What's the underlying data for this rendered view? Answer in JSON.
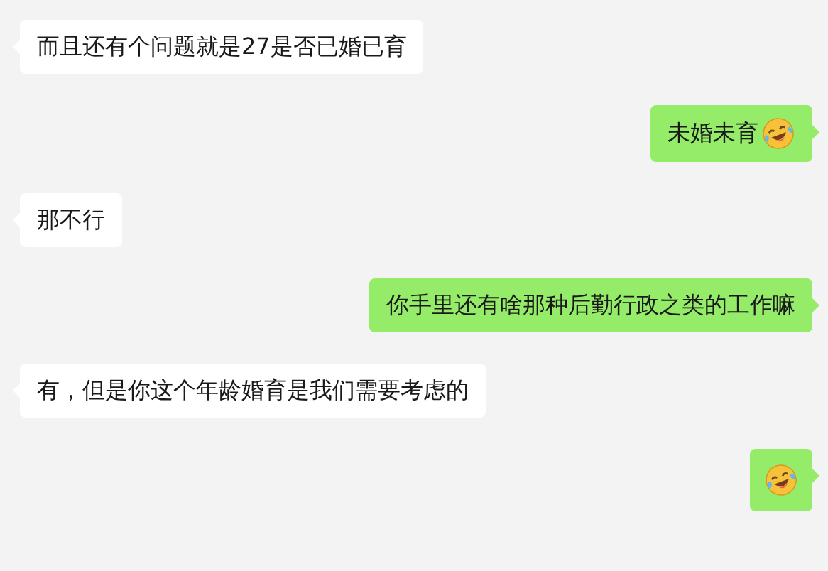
{
  "messages": [
    {
      "kind": "incoming",
      "text": "而且还有个问题就是27是否已婚已育",
      "emoji": false
    },
    {
      "kind": "outgoing",
      "text": "未婚未育",
      "emoji": true
    },
    {
      "kind": "incoming",
      "text": "那不行",
      "emoji": false
    },
    {
      "kind": "outgoing",
      "text": "你手里还有啥那种后勤行政之类的工作嘛",
      "emoji": false
    },
    {
      "kind": "incoming",
      "text": "有，但是你这个年龄婚育是我们需要考虑的",
      "emoji": false
    },
    {
      "kind": "outgoing",
      "emoji": true
    }
  ]
}
